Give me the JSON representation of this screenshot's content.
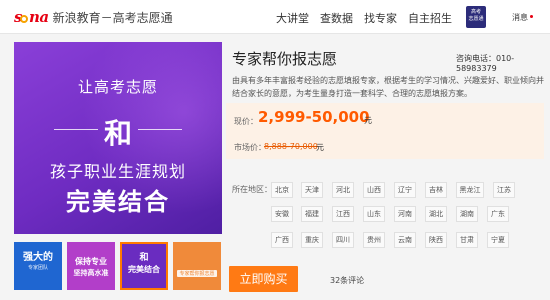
{
  "header": {
    "logo_brand": "sina",
    "site_title": "新浪教育－高考志愿通",
    "nav": [
      "大讲堂",
      "查数据",
      "找专家",
      "自主招生"
    ],
    "avatar_text": "高考\n志愿通",
    "messages_label": "消息"
  },
  "banner": {
    "line1": "让高考志愿",
    "line2": "和",
    "line3": "孩子职业生涯规划",
    "line4": "完美结合"
  },
  "thumbnails": [
    {
      "big": "强大的",
      "small": "专家团队"
    },
    {
      "big": "保持专业",
      "small": "坚持高水准"
    },
    {
      "big": "完美结合",
      "small": "和"
    },
    {
      "big": "",
      "small": "专家帮你报志愿"
    }
  ],
  "product": {
    "title": "专家帮你报志愿",
    "phone": "咨询电话：010-58983379",
    "description": "由具有多年丰富报考经验的志愿填报专家，根据考生的学习情况、兴趣爱好、职业倾向并结合家长的意愿，为考生量身打造一套科学、合理的志愿填报方案。",
    "price_label": "现价：",
    "price_value": "2,999-50,000",
    "price_unit": "元",
    "market_label": "市场价：",
    "market_value": "8,888-70,000",
    "market_unit": "元",
    "region_label": "所在地区：",
    "regions": [
      "北京",
      "天津",
      "河北",
      "山西",
      "辽宁",
      "吉林",
      "黑龙江",
      "江苏",
      "安徽",
      "福建",
      "江西",
      "山东",
      "河南",
      "湖北",
      "湖南",
      "广东",
      "广西",
      "重庆",
      "四川",
      "贵州",
      "云南",
      "陕西",
      "甘肃",
      "宁夏"
    ],
    "buy_label": "立即购买",
    "comments": "32条评论"
  },
  "colors": {
    "accent_orange": "#ff7a14",
    "price_orange": "#ff5a00",
    "brand_red": "#e60012",
    "banner_purple": "#7a33cc"
  }
}
